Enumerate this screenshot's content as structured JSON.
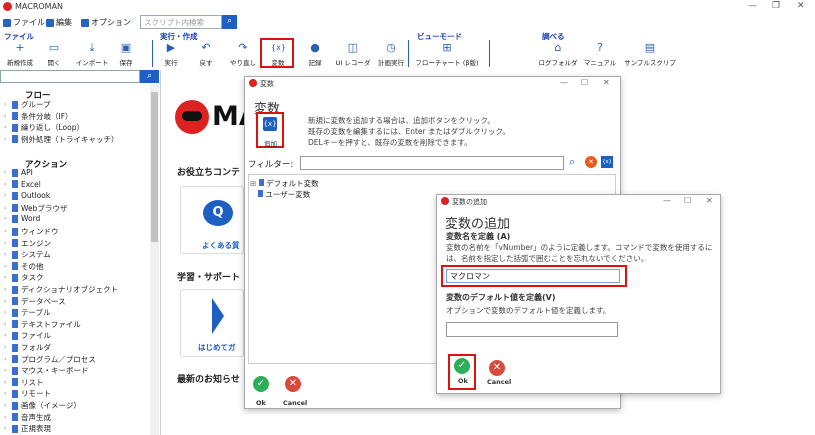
{
  "app": {
    "title": "MACROMAN"
  },
  "menu": {
    "file": "ファイル",
    "edit": "編集",
    "options": "オプション"
  },
  "search": {
    "placeholder": "スクリプト内検索"
  },
  "groups": {
    "file": "ファイル",
    "run": "実行・作成",
    "view": "ビューモード",
    "learn": "調べる"
  },
  "toolbar": [
    {
      "label": "新規作成",
      "icon": "+"
    },
    {
      "label": "開く",
      "icon": "▭"
    },
    {
      "label": "インポート",
      "icon": "⤓"
    },
    {
      "label": "保存",
      "icon": "▣"
    },
    {
      "label": "実行",
      "icon": "▶"
    },
    {
      "label": "戻す",
      "icon": "↶"
    },
    {
      "label": "やり直し",
      "icon": "↷"
    },
    {
      "label": "変数",
      "icon": "{x}"
    },
    {
      "label": "記録",
      "icon": "●"
    },
    {
      "label": "UI レコーダー",
      "icon": "◫"
    },
    {
      "label": "計画実行",
      "icon": "◷"
    },
    {
      "label": "フローチャート (β版)",
      "icon": "⊞"
    },
    {
      "label": "ログフォルダ",
      "icon": "⌂"
    },
    {
      "label": "マニュアル",
      "icon": "?"
    },
    {
      "label": "サンプルスクリプト",
      "icon": "▤"
    }
  ],
  "sidebar": {
    "flow_heading": "フロー",
    "flow_items": [
      "グループ",
      "条件分岐（IF）",
      "繰り返し（Loop）",
      "例外処理（トライキャッチ）"
    ],
    "action_heading": "アクション",
    "action_items": [
      "API",
      "Excel",
      "Outlook",
      "Webブラウザ",
      "Word",
      "ウィンドウ",
      "エンジン",
      "システム",
      "その他",
      "タスク",
      "ディクショナリオブジェクト",
      "データベース",
      "テーブル",
      "テキストファイル",
      "ファイル",
      "フォルダ",
      "プログラム／プロセス",
      "マウス・キーボード",
      "リスト",
      "リモート",
      "画像（イメージ）",
      "音声生成",
      "正規表現"
    ]
  },
  "main": {
    "brand": "MA",
    "useful": "お役立ちコンテ",
    "faq": "よくある質",
    "learn": "学習・サポート",
    "start": "はじめてガ",
    "news": "最新のお知らせ"
  },
  "var_dialog": {
    "title": "変数",
    "heading": "変数",
    "add_label": "追加",
    "help": [
      "新規に変数を追加する場合は、追加ボタンをクリック。",
      "既存の変数を編集するには、Enter またはダブルクリック。",
      "DELキーを押すと、既存の変数を削除できます。"
    ],
    "filter_label": "フィルター:",
    "tree": [
      "デフォルト変数",
      "ユーザー変数"
    ],
    "ok": "Ok",
    "cancel": "Cancel"
  },
  "add_dialog": {
    "title": "変数の追加",
    "heading": "変数の追加",
    "name_label": "変数名を定義 (A)",
    "name_help": "変数の名前を「vNumber」のように定義します。コマンドで変数を使用するには、名前を指定した括弧で囲むことを忘れないでください。",
    "name_value": "マクロマン",
    "default_label": "変数のデフォルト値を定義(V)",
    "default_help": "オプションで変数のデフォルト値を定義します。",
    "default_value": "",
    "ok": "Ok",
    "cancel": "Cancel"
  },
  "colors": {
    "accent": "#1e5fc4",
    "highlight": "#d11111",
    "ok": "#2fae5a",
    "cancel": "#d94a3c"
  }
}
